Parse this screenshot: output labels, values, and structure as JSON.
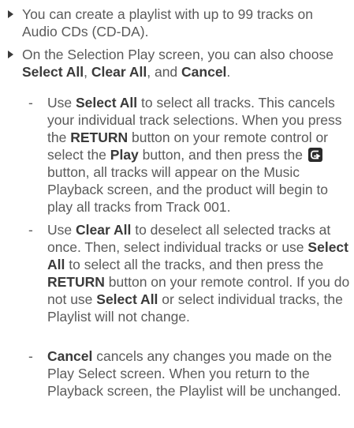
{
  "bullets": [
    {
      "text": "You can create a playlist with up to 99 tracks on Audio CDs (CD-DA)."
    },
    {
      "text_1": "On the Selection Play screen, you can also choose ",
      "select_all": "Select All",
      "sep_1": ", ",
      "clear_all": "Clear All",
      "sep_2": ", and ",
      "cancel": "Cancel",
      "end": "."
    }
  ],
  "sub_items": [
    {
      "dash": "-",
      "t1": "Use ",
      "b1": "Select All",
      "t2": " to select all tracks. This cancels your individual track selections. When you press the ",
      "b2": "RETURN",
      "t3": " button on your remote control or select the ",
      "b3": "Play",
      "t4": " button, and then press the ",
      "t5": " button, all tracks will appear on the Music Playback screen, and the product will begin to play all tracks from Track 001.",
      "icon": "return-icon"
    },
    {
      "dash": "-",
      "t1": "Use ",
      "b1": "Clear All",
      "t2": " to deselect all selected tracks at once. Then, select individual tracks or use ",
      "b2": "Select All",
      "t3": " to select all the tracks, and then press the ",
      "b3": "RETURN",
      "t4": " button on your remote control. If you do not use ",
      "b4": "Select All",
      "t5": " or select individual tracks, the Playlist will not change."
    },
    {
      "dash": "-",
      "b1": "Cancel",
      "t1": " cancels any changes you made on the Play Select screen. When you return to the Playback screen, the Playlist will be unchanged."
    }
  ]
}
